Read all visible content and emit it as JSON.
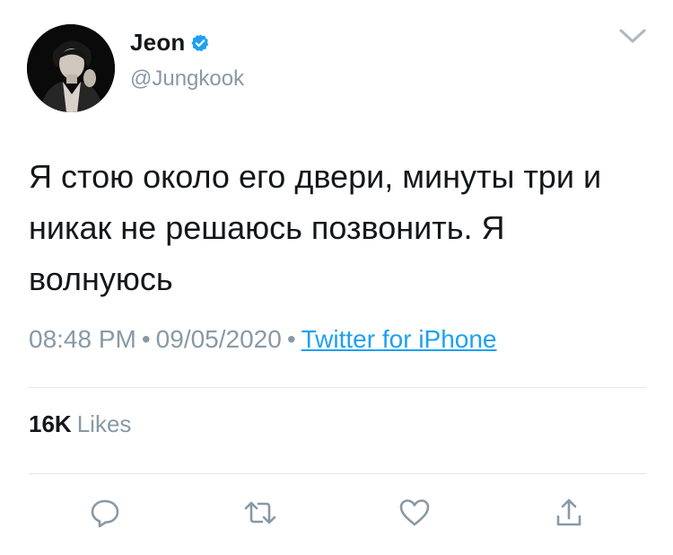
{
  "author": {
    "display_name": "Jeon",
    "handle": "@Jungkook",
    "verified": true,
    "verified_color": "#1da1f2"
  },
  "tweet": {
    "text": "Я стою около его двери, минуты три и никак не решаюсь позвонить. Я волнуюсь",
    "time": "08:48 PM",
    "date": "09/05/2020",
    "source": "Twitter for iPhone",
    "separator": "•"
  },
  "stats": {
    "likes_count": "16K",
    "likes_label": "Likes"
  },
  "actions": [
    {
      "icon": "reply-icon"
    },
    {
      "icon": "retweet-icon"
    },
    {
      "icon": "like-icon"
    },
    {
      "icon": "share-icon"
    }
  ],
  "colors": {
    "link": "#1da1f2",
    "muted": "#8899a6",
    "text": "#14171a",
    "divider": "#e1e8ed"
  }
}
